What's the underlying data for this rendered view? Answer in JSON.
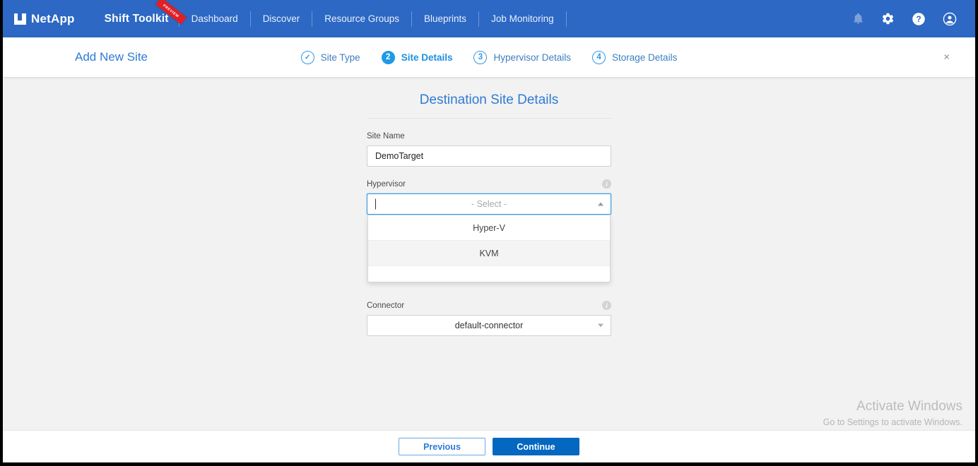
{
  "topnav": {
    "logo_text": "NetApp",
    "logo_icon": "netapp-logo-icon",
    "brand": "Shift Toolkit",
    "ribbon_label": "PREVIEW",
    "nav_items": [
      {
        "label": "Dashboard"
      },
      {
        "label": "Discover"
      },
      {
        "label": "Resource Groups"
      },
      {
        "label": "Blueprints"
      },
      {
        "label": "Job Monitoring"
      }
    ],
    "icons": [
      {
        "name": "bell-icon"
      },
      {
        "name": "gear-icon"
      },
      {
        "name": "help-icon"
      },
      {
        "name": "account-icon"
      }
    ],
    "accent": "#2c68c4"
  },
  "wizard": {
    "title": "Add New Site",
    "close_label": "×",
    "steps": [
      {
        "num": "✓",
        "label": "Site Type",
        "state": "done"
      },
      {
        "num": "2",
        "label": "Site Details",
        "state": "active"
      },
      {
        "num": "3",
        "label": "Hypervisor Details",
        "state": "todo"
      },
      {
        "num": "4",
        "label": "Storage Details",
        "state": "todo"
      }
    ]
  },
  "form": {
    "title": "Destination Site Details",
    "site_name": {
      "label": "Site Name",
      "value": "DemoTarget"
    },
    "hypervisor": {
      "label": "Hypervisor",
      "placeholder": "- Select -",
      "value": "",
      "info_icon": "info-icon",
      "options": [
        {
          "label": "Hyper-V",
          "hovered": false
        },
        {
          "label": "KVM",
          "hovered": true
        }
      ]
    },
    "connector": {
      "label": "Connector",
      "value": "default-connector",
      "info_icon": "info-icon"
    }
  },
  "watermark": {
    "line1": "Activate Windows",
    "line2": "Go to Settings to activate Windows."
  },
  "footer": {
    "previous_label": "Previous",
    "continue_label": "Continue",
    "primary_color": "#0467c0"
  }
}
